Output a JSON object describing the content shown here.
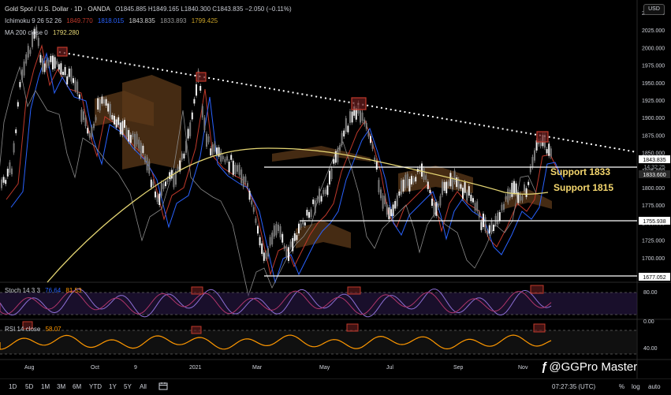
{
  "header": {
    "symbol": "Gold Spot / U.S. Dollar · 1D · OANDA",
    "ohlc": "O1845.885 H1849.165 L1840.300 C1843.835 −2.050 (−0.11%)",
    "ichimoku_label": "Ichimoku 9 26 52 26",
    "ichimoku_values": [
      "1849.770",
      "1818.015",
      "1843.835",
      "1833.893",
      "1799.425"
    ],
    "ichimoku_colors": [
      "#c0392b",
      "#2962ff",
      "#cfcfcf",
      "#9a9a9a",
      "#c9a227"
    ],
    "ma_label": "MA 200 close 0",
    "ma_value": "1792.280",
    "currency": "USD"
  },
  "price_axis": {
    "ticks": [
      "2050.000",
      "2025.000",
      "2000.000",
      "1975.000",
      "1950.000",
      "1925.000",
      "1900.000",
      "1875.000",
      "1850.000",
      "1825.000",
      "1800.000",
      "1775.000",
      "1750.000",
      "1725.000",
      "1700.000"
    ],
    "current_price": "1843.835",
    "countdown": "14:32:25",
    "level_labels": [
      "1833.600",
      "1755.938",
      "1677.052"
    ]
  },
  "annotations": {
    "support1": "Support 1833",
    "support2": "Support 1815"
  },
  "stoch": {
    "label": "Stoch 14 3 3",
    "k": "76.64",
    "d": "81.53",
    "ticks": [
      "80.00",
      "0.00"
    ]
  },
  "rsi": {
    "label": "RSI 14 close",
    "value": "58.07",
    "ticks": [
      "40.00"
    ]
  },
  "time_axis": [
    "Aug",
    "Oct",
    "9",
    "2021",
    "Mar",
    "May",
    "Jul",
    "Sep",
    "Nov"
  ],
  "toolbar": {
    "timeframes": [
      "1D",
      "5D",
      "1M",
      "3M",
      "6M",
      "YTD",
      "1Y",
      "5Y",
      "All"
    ],
    "clock": "07:27:35 (UTC)",
    "percent": "%",
    "log": "log",
    "auto": "auto"
  },
  "watermark": "@GGPro Master",
  "colors": {
    "background": "#000000",
    "candle": "#e8e8e8",
    "support": "#ffffff",
    "support_text": "#f5d76e",
    "ma": "#e6d774",
    "cloud": "#5c3a1a",
    "stoch_k": "#8e6fd6",
    "stoch_d": "#b0356b",
    "rsi": "#ff9800",
    "marker": "#c0392b"
  }
}
